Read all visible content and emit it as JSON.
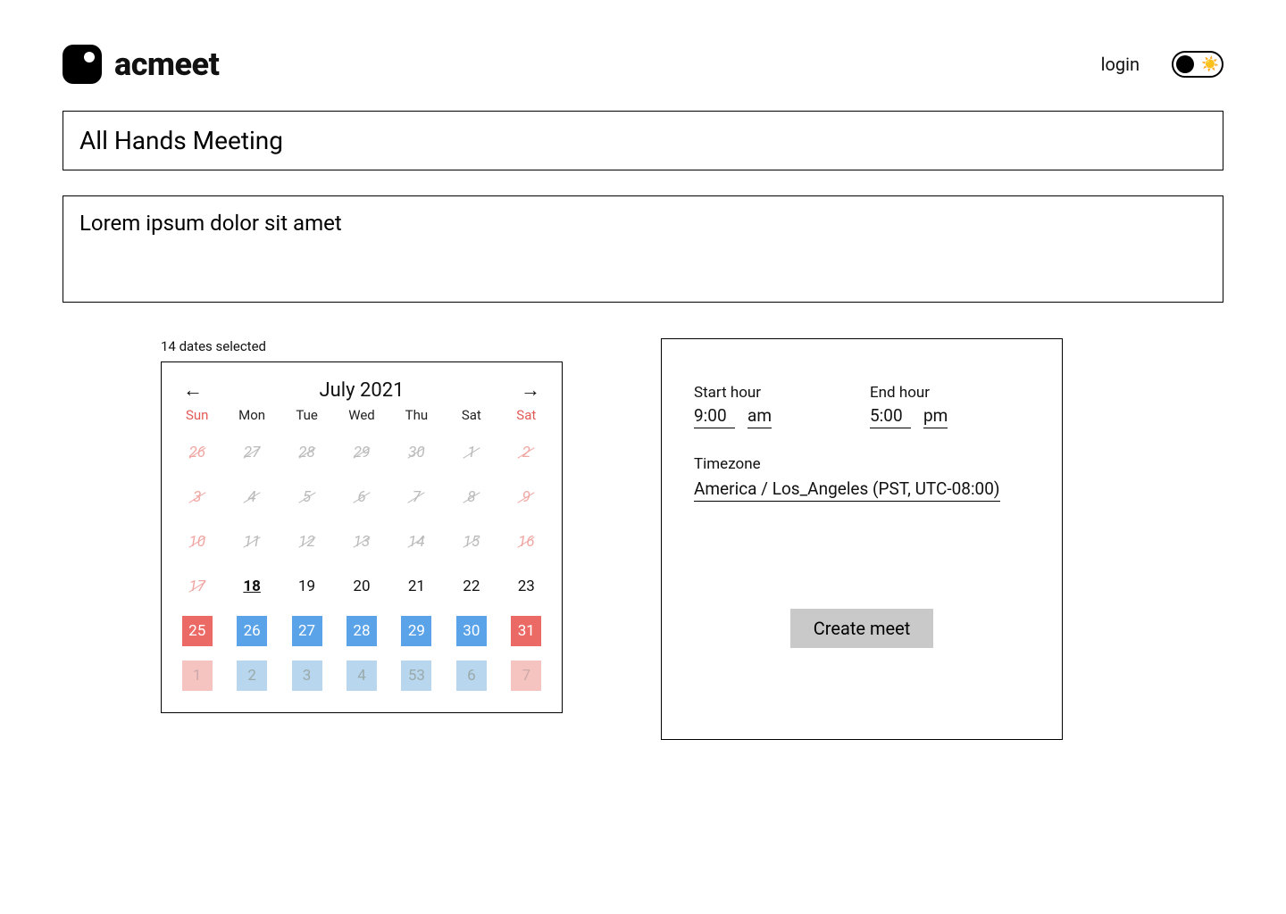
{
  "header": {
    "brand": "acmeet",
    "login": "login"
  },
  "title_value": "All Hands Meeting",
  "desc_value": "Lorem ipsum dolor sit amet",
  "selected_count_text": "14 dates selected",
  "calendar": {
    "month_label": "July 2021",
    "dow": [
      "Sun",
      "Mon",
      "Tue",
      "Wed",
      "Thu",
      "Sat",
      "Sat"
    ],
    "cells": [
      {
        "n": "26",
        "past": true,
        "weekend": true
      },
      {
        "n": "27",
        "past": true
      },
      {
        "n": "28",
        "past": true
      },
      {
        "n": "29",
        "past": true
      },
      {
        "n": "30",
        "past": true
      },
      {
        "n": "1",
        "past": true
      },
      {
        "n": "2",
        "past": true,
        "weekend": true
      },
      {
        "n": "3",
        "past": true,
        "weekend": true
      },
      {
        "n": "4",
        "past": true
      },
      {
        "n": "5",
        "past": true
      },
      {
        "n": "6",
        "past": true
      },
      {
        "n": "7",
        "past": true
      },
      {
        "n": "8",
        "past": true
      },
      {
        "n": "9",
        "past": true,
        "weekend": true
      },
      {
        "n": "10",
        "past": true,
        "weekend": true
      },
      {
        "n": "11",
        "past": true
      },
      {
        "n": "12",
        "past": true
      },
      {
        "n": "13",
        "past": true
      },
      {
        "n": "14",
        "past": true
      },
      {
        "n": "15",
        "past": true
      },
      {
        "n": "16",
        "past": true,
        "weekend": true
      },
      {
        "n": "17",
        "past": true,
        "weekend": true
      },
      {
        "n": "18",
        "today": true
      },
      {
        "n": "19"
      },
      {
        "n": "20"
      },
      {
        "n": "21"
      },
      {
        "n": "22"
      },
      {
        "n": "23"
      },
      {
        "n": "25",
        "sel": "red"
      },
      {
        "n": "26",
        "sel": "blue"
      },
      {
        "n": "27",
        "sel": "blue"
      },
      {
        "n": "28",
        "sel": "blue"
      },
      {
        "n": "29",
        "sel": "blue"
      },
      {
        "n": "30",
        "sel": "blue"
      },
      {
        "n": "31",
        "sel": "red"
      },
      {
        "n": "1",
        "sel": "red",
        "next": true
      },
      {
        "n": "2",
        "sel": "blue",
        "next": true
      },
      {
        "n": "3",
        "sel": "blue",
        "next": true
      },
      {
        "n": "4",
        "sel": "blue",
        "next": true
      },
      {
        "n": "53",
        "sel": "blue",
        "next": true
      },
      {
        "n": "6",
        "sel": "blue",
        "next": true
      },
      {
        "n": "7",
        "sel": "red",
        "next": true
      }
    ]
  },
  "hours": {
    "start_label": "Start hour",
    "start_value": "9:00",
    "start_ampm": "am",
    "end_label": "End hour",
    "end_value": "5:00",
    "end_ampm": "pm",
    "tz_label": "Timezone",
    "tz_value": "America / Los_Angeles (PST, UTC-08:00)"
  },
  "create_label": "Create meet"
}
